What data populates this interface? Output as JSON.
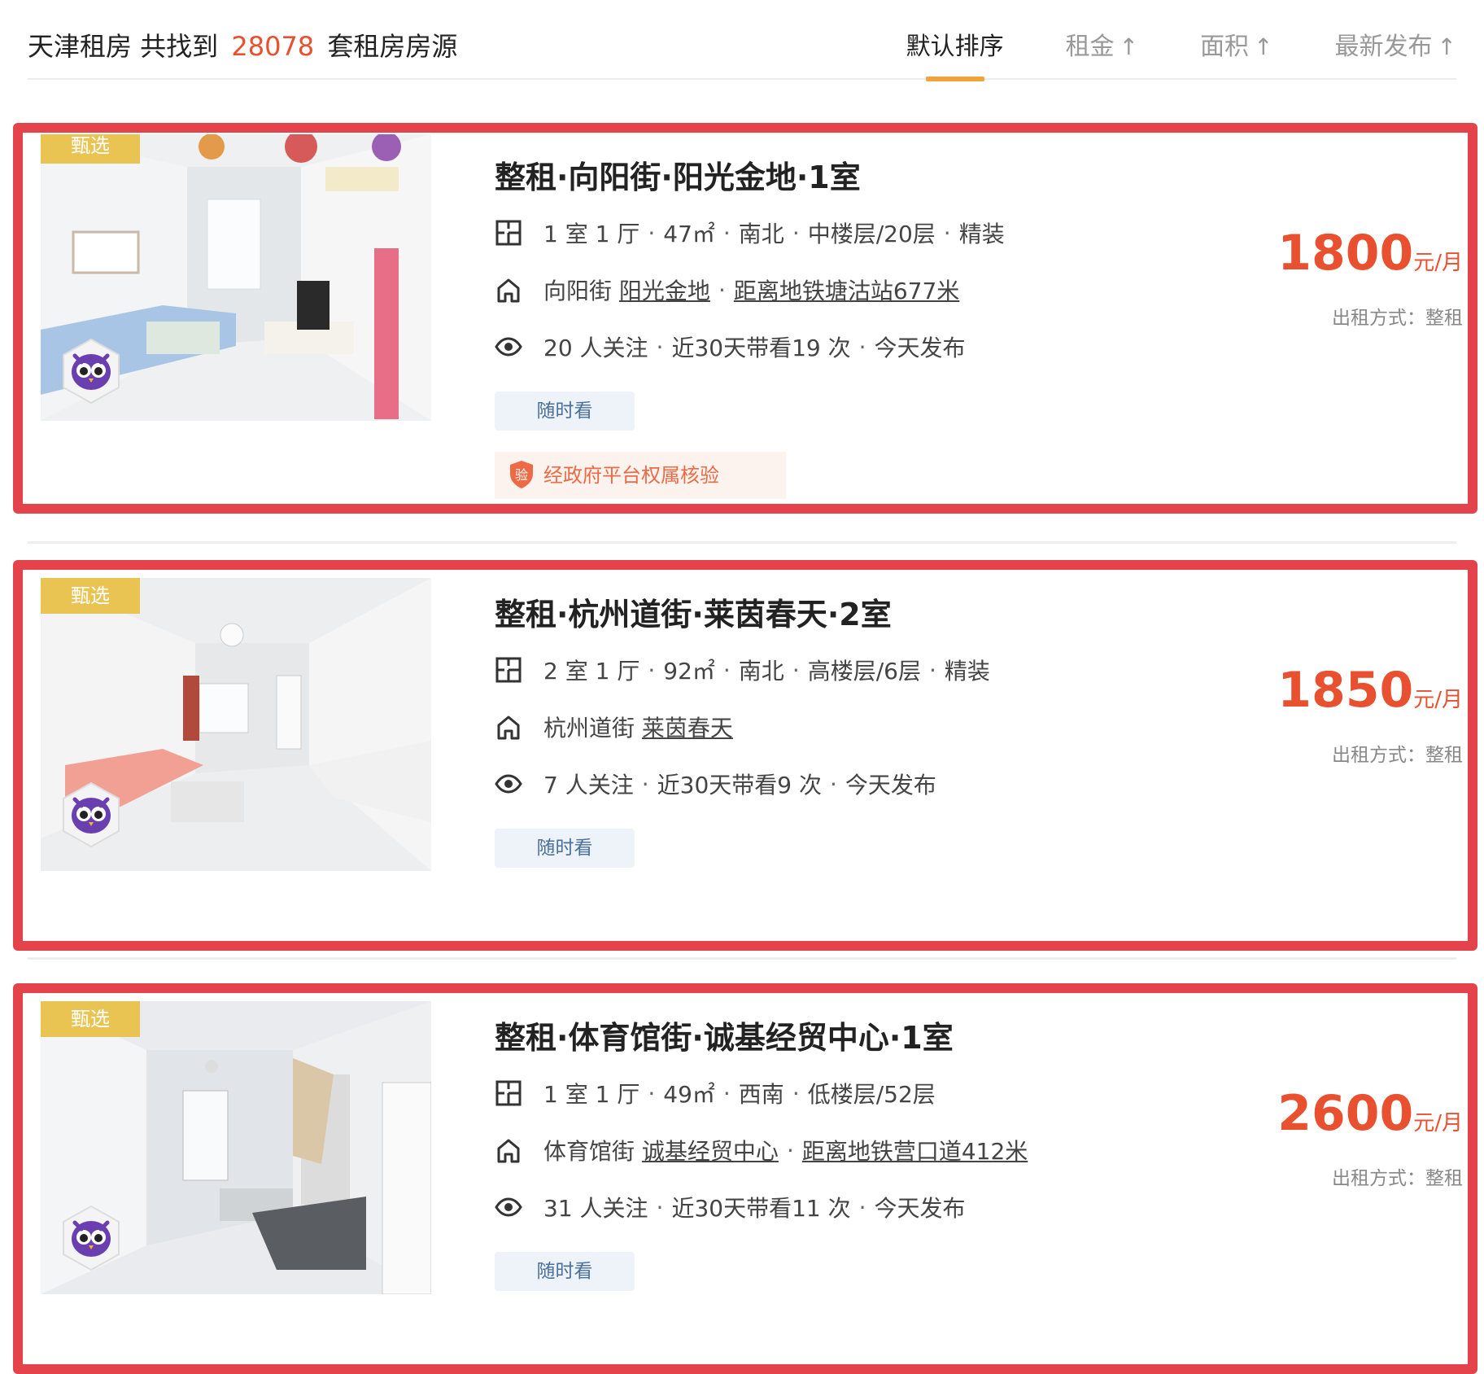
{
  "header": {
    "summary_prefix": "天津租房 共找到",
    "summary_count": "28078",
    "summary_suffix": "套租房房源",
    "sort_tabs": [
      {
        "label": "默认排序",
        "arrow": ""
      },
      {
        "label": "租金",
        "arrow": "↑"
      },
      {
        "label": "面积",
        "arrow": "↑"
      },
      {
        "label": "最新发布",
        "arrow": "↑"
      }
    ]
  },
  "colors": {
    "accent": "#e8502f",
    "highlight_border": "#e5434b",
    "badge": "#e9c452",
    "sort_underline": "#f0a43c"
  },
  "listings": [
    {
      "badge": "甄选",
      "title": "整租·向阳街·阳光金地·1室",
      "layout": "1 室 1 厅",
      "area": "47㎡",
      "orientation": "南北",
      "floor": "中楼层/20层",
      "decoration": "精装",
      "district": "向阳街",
      "community": "阳光金地",
      "subway": "距离地铁塘沽站677米",
      "followers": "20 人关注",
      "visits": "近30天带看19 次",
      "published": "今天发布",
      "tag": "随时看",
      "verify": "经政府平台权属核验",
      "price": "1800",
      "price_unit": "元/月",
      "rent_type": "出租方式：整租"
    },
    {
      "badge": "甄选",
      "title": "整租·杭州道街·莱茵春天·2室",
      "layout": "2 室 1 厅",
      "area": "92㎡",
      "orientation": "南北",
      "floor": "高楼层/6层",
      "decoration": "精装",
      "district": "杭州道街",
      "community": "莱茵春天",
      "followers": "7 人关注",
      "visits": "近30天带看9 次",
      "published": "今天发布",
      "tag": "随时看",
      "price": "1850",
      "price_unit": "元/月",
      "rent_type": "出租方式：整租"
    },
    {
      "badge": "甄选",
      "title": "整租·体育馆街·诚基经贸中心·1室",
      "layout": "1 室 1 厅",
      "area": "49㎡",
      "orientation": "西南",
      "floor": "低楼层/52层",
      "district": "体育馆街",
      "community": "诚基经贸中心",
      "subway": "距离地铁营口道412米",
      "followers": "31 人关注",
      "visits": "近30天带看11 次",
      "published": "今天发布",
      "tag": "随时看",
      "price": "2600",
      "price_unit": "元/月",
      "rent_type": "出租方式：整租"
    }
  ]
}
